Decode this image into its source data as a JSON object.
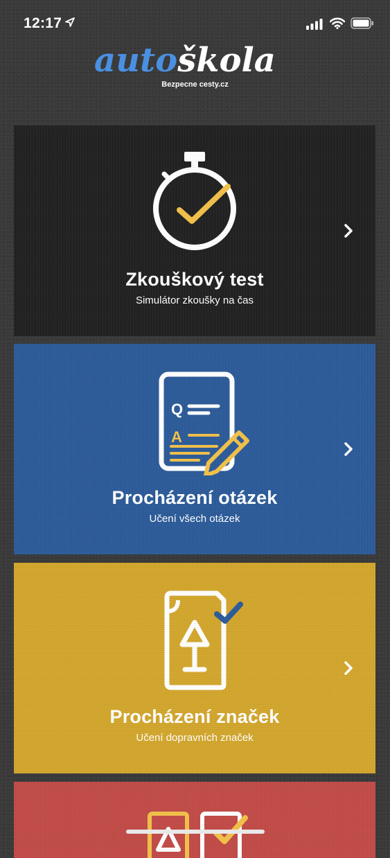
{
  "status_bar": {
    "time": "12:17"
  },
  "logo": {
    "part1": "auto",
    "part2": "škola",
    "tagline": "Bezpecne cesty.cz"
  },
  "colors": {
    "accent_yellow": "#f2c14a",
    "accent_blue": "#4a90e2",
    "card_dark": "#222222",
    "card_blue": "#2d5c9a",
    "card_yellow": "#d3a72e",
    "card_red": "#c24c48"
  },
  "cards": [
    {
      "title": "Zkouškový test",
      "subtitle": "Simulátor zkoušky na čas",
      "icon": "stopwatch-check-icon"
    },
    {
      "title": "Procházení otázek",
      "subtitle": "Učení všech otázek",
      "icon": "question-document-pencil-icon"
    },
    {
      "title": "Procházení značek",
      "subtitle": "Učení dopravních značek",
      "icon": "traffic-sign-document-icon"
    },
    {
      "title": "",
      "subtitle": "",
      "icon": "signs-checkbox-icon"
    }
  ]
}
